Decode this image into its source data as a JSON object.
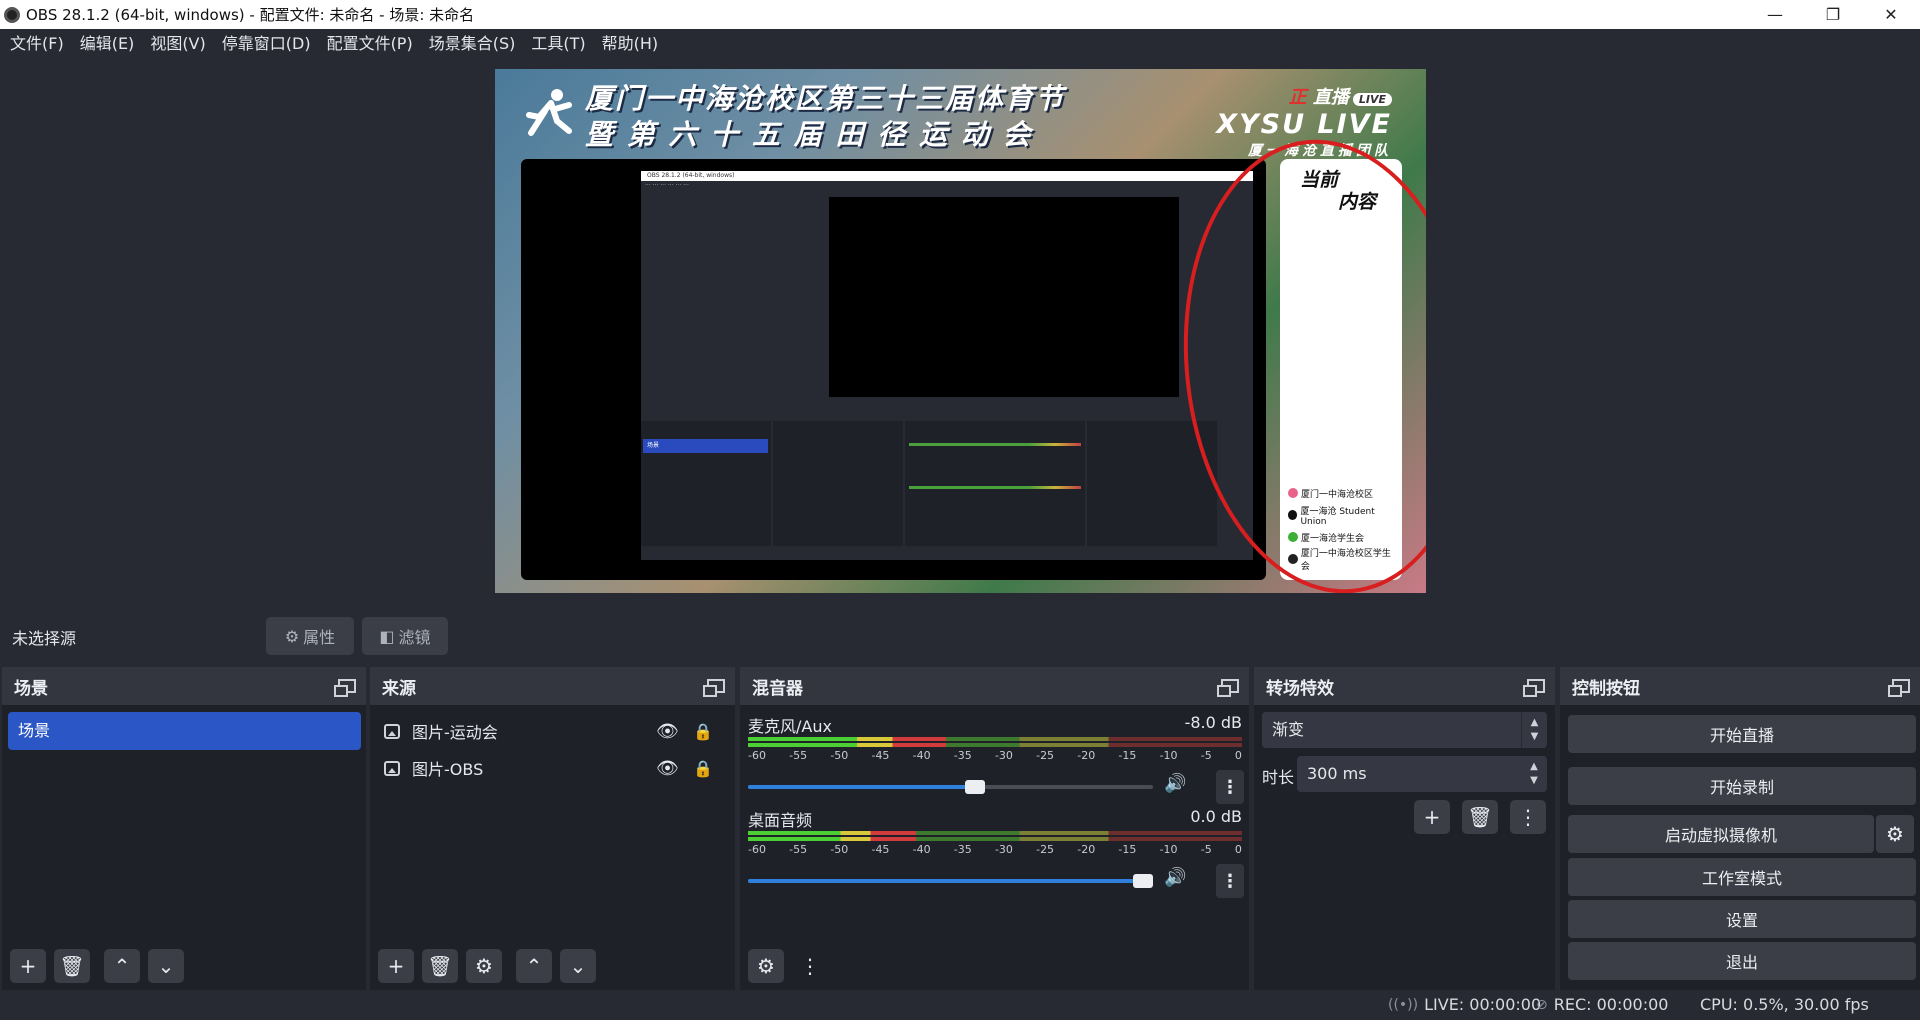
{
  "window": {
    "title": "OBS 28.1.2 (64-bit, windows) - 配置文件: 未命名 - 场景: 未命名",
    "minimize": "—",
    "restore": "❐",
    "close": "✕"
  },
  "menu": [
    "文件(F)",
    "编辑(E)",
    "视图(V)",
    "停靠窗口(D)",
    "配置文件(P)",
    "场景集合(S)",
    "工具(T)",
    "帮助(H)"
  ],
  "preview": {
    "banner_line1": "厦门一中海沧校区第三十三届体育节",
    "banner_line2": "暨 第 六 十 五 届 田 径 运 动 会",
    "live_top_red": "正",
    "live_top": "直播",
    "live_badge": "LIVE",
    "live_brand": "XYSU LIVE",
    "live_team": "厦一海沧直播团队",
    "side_current_1": "当前",
    "side_current_2": "内容",
    "side_rows": [
      "厦门一中海沧校区",
      "厦一海沧 Student Union",
      "厦一海沧学生会",
      "厦门一中海沧校区学生会"
    ],
    "mini_title": "OBS 28.1.2 (64-bit, windows)",
    "mini_scene": "场景"
  },
  "source_toolbar": {
    "no_source": "未选择源",
    "properties": "属性",
    "filters": "滤镜"
  },
  "docks": {
    "scenes": {
      "title": "场景",
      "items": [
        "场景"
      ]
    },
    "sources": {
      "title": "来源",
      "items": [
        "图片-运动会",
        "图片-OBS"
      ]
    },
    "mixer": {
      "title": "混音器",
      "ticks": [
        "-60",
        "-55",
        "-50",
        "-45",
        "-40",
        "-35",
        "-30",
        "-25",
        "-20",
        "-15",
        "-10",
        "-5",
        "0"
      ],
      "channels": [
        {
          "name": "麦克风/Aux",
          "db": "-8.0 dB",
          "volume": 0.56
        },
        {
          "name": "桌面音频",
          "db": "0.0 dB",
          "volume": 1.0
        }
      ]
    },
    "transitions": {
      "title": "转场特效",
      "selected": "渐变",
      "duration_label": "时长",
      "duration": "300 ms"
    },
    "controls": {
      "title": "控制按钮",
      "buttons": [
        "开始直播",
        "开始录制",
        "启动虚拟摄像机",
        "工作室模式",
        "设置",
        "退出"
      ]
    }
  },
  "status": {
    "live": "LIVE: 00:00:00",
    "rec": "REC: 00:00:00",
    "cpu": "CPU: 0.5%, 30.00 fps"
  },
  "colors": {
    "scene_selected": "#2b56c6",
    "slider_blue": "#2f7fdc",
    "annotation_red": "#d81e1e"
  }
}
